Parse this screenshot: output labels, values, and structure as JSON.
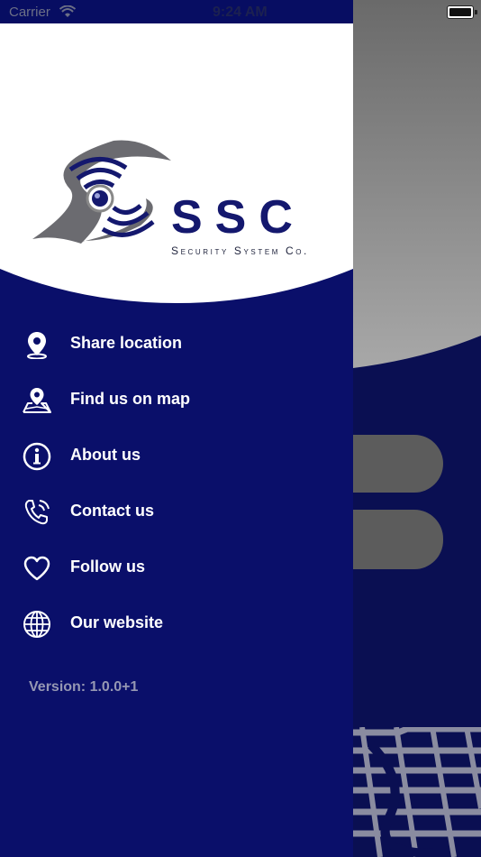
{
  "status_bar": {
    "carrier": "Carrier",
    "time": "9:24 AM"
  },
  "logo": {
    "text": "SSC",
    "subtitle": "Security System Co."
  },
  "menu": {
    "items": [
      {
        "label": "Share location",
        "icon": "location-pin-icon"
      },
      {
        "label": "Find us on map",
        "icon": "map-pin-icon"
      },
      {
        "label": "About us",
        "icon": "info-icon"
      },
      {
        "label": "Contact us",
        "icon": "phone-icon"
      },
      {
        "label": "Follow us",
        "icon": "heart-icon"
      },
      {
        "label": "Our website",
        "icon": "globe-icon"
      }
    ]
  },
  "version": "Version: 1.0.0+1",
  "colors": {
    "drawer": "#0a0f6a",
    "background": "#0a0f52",
    "header": "#ffffff",
    "grey": "#5c5c5c"
  }
}
